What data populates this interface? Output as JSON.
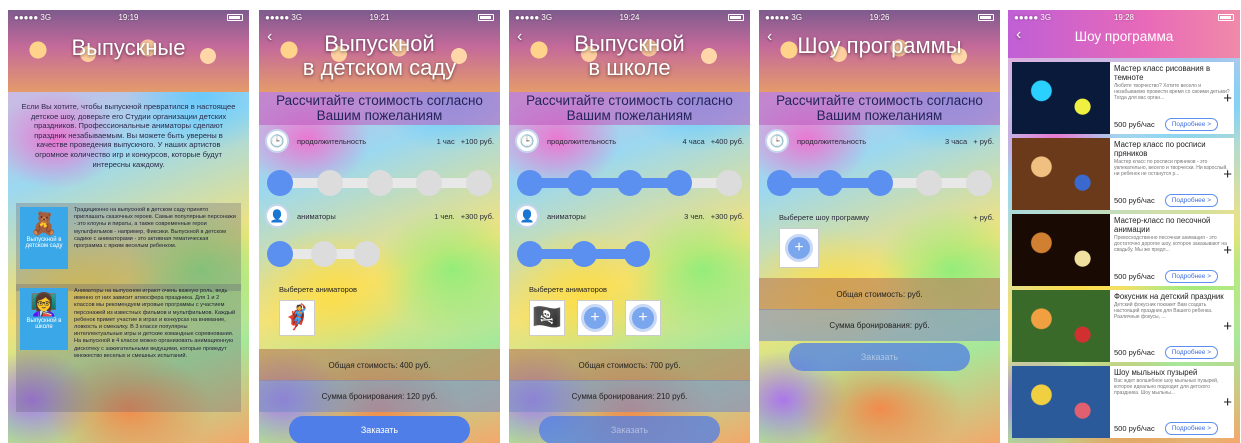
{
  "colors": {
    "accent": "#5b8ff0",
    "button": "#4f7ee8",
    "header": "#d062c8",
    "slider_inactive": "#dcdcdc"
  },
  "screens": [
    {
      "status": {
        "signal": "●●●●● 3G",
        "time": "19:19"
      },
      "title": "Выпускные",
      "intro": "Если Вы хотите, чтобы выпускной превратился в настоящее детское шоу, доверьте его Студии организации детских праздников. Профессиональные аниматоры сделают праздник незабываемым. Вы можете быть уверены в качестве проведения выпускного. У наших артистов огромное количество игр и конкурсов, которые будут интересны каждому.",
      "features": [
        {
          "tile_label": "Выпускной в детском саду",
          "icon": "teddy-bear-icon",
          "text": "Традиционно на выпускной в детском саду принято приглашать сказочных героев. Самые популярные персонажи - это клоуны и пираты, а также современные герои мультфильмов - например, Фиксики. Выпускной в детском садике с аниматорами - это активная тематическая программа с ярким веселым ребенком."
        },
        {
          "tile_label": "Выпускной в школе",
          "icon": "teacher-board-icon",
          "text": "Аниматоры на выпускном играют очень важную роль, ведь именно от них зависит атмосфера праздника. Для 1 и 2 классов мы рекомендуем игровые программы с участием персонажей из известных фильмов и мультфильмов. Каждый ребенок примет участие в играх и конкурсах на внимание, ловкость и смекалку. В 3 классе популярны интеллектуальные игры и детские командные соревнования. На выпускной в 4 классе можно организовать анимационную дискотеку с зажигательными ведущими, которые проведут множество веселых и смешных испытаний."
        }
      ]
    },
    {
      "status": {
        "signal": "●●●●● 3G",
        "time": "19:21"
      },
      "title_line1": "Выпускной",
      "title_line2": "в детском саду",
      "heading": "Рассчитайте стоимость согласно Вашим пожеланиям",
      "duration": {
        "label": "продолжительность",
        "value": "1 час",
        "price": "+100 руб.",
        "level": 1,
        "steps": 5
      },
      "animators": {
        "label": "аниматоры",
        "value": "1 чел.",
        "price": "+300 руб.",
        "level": 1,
        "steps": 3
      },
      "choose_label": "Выберете аниматоров",
      "total": "Общая стоимость: 400 руб.",
      "booking": "Сумма бронирования: 120 руб.",
      "order": "Заказать"
    },
    {
      "status": {
        "signal": "●●●●● 3G",
        "time": "19:24"
      },
      "title_line1": "Выпускной",
      "title_line2": "в школе",
      "heading": "Рассчитайте стоимость согласно Вашим пожеланиям",
      "duration": {
        "label": "продолжительность",
        "value": "4 часа",
        "price": "+400 руб.",
        "level": 4,
        "steps": 5
      },
      "animators": {
        "label": "аниматоры",
        "value": "3 чел.",
        "price": "+300 руб.",
        "level": 3,
        "steps": 3
      },
      "choose_label": "Выберете аниматоров",
      "total": "Общая стоимость: 700 руб.",
      "booking": "Сумма бронирования: 210 руб.",
      "order": "Заказать"
    },
    {
      "status": {
        "signal": "●●●●● 3G",
        "time": "19:26"
      },
      "title": "Шоу программы",
      "heading": "Рассчитайте стоимость согласно Вашим пожеланиям",
      "duration": {
        "label": "продолжительность",
        "value": "3 часа",
        "price": "+ руб.",
        "level": 3,
        "steps": 5
      },
      "show_select": {
        "label": "Выберете шоу программу",
        "price": "+ руб."
      },
      "total": "Общая стоимость: руб.",
      "booking": "Сумма бронирования: руб.",
      "order": "Заказать"
    },
    {
      "status": {
        "signal": "●●●●● 3G",
        "time": "19:28"
      },
      "title": "Шоу программа",
      "items": [
        {
          "title": "Мастер класс рисования в темноте",
          "desc": "Любите творчество? Хотите весело и незабываемо провести время со своими детьми? Тогда для вас орган...",
          "price": "500 руб/час",
          "more": "Подробнее >",
          "photo": [
            "#0a1a3a",
            "#2ad0ff",
            "#f0f040"
          ]
        },
        {
          "title": "Мастер класс по росписи пряников",
          "desc": "Мастер класс по росписи пряников - это увлекательно, весело и творчески. Ни взрослый, ни ребенок не останутся р...",
          "price": "500 руб/час",
          "more": "Подробнее >",
          "photo": [
            "#6a3a1a",
            "#f0c080",
            "#3a6ad0"
          ]
        },
        {
          "title": "Мастер-класс по песочной анимации",
          "desc": "Превосходственно песочная анимация - это достаточно дорогое шоу, которое заказывают на свадьбу. Мы же предл...",
          "price": "500 руб/час",
          "more": "Подробнее >",
          "photo": [
            "#1a0a04",
            "#d08030",
            "#f0e0a0"
          ]
        },
        {
          "title": "Фокусник на детский праздник",
          "desc": "Детский фокусник покажет Вам создать настоящий праздник для Вашего ребенка. Различные фокусы, ...",
          "price": "500 руб/час",
          "more": "Подробнее >",
          "photo": [
            "#3a6a2a",
            "#f0a040",
            "#d03030"
          ]
        },
        {
          "title": "Шоу мыльных пузырей",
          "desc": "Вас ждет волшебное шоу мыльных пузырей, которое идеально подходит для детского праздника. Шоу мыльны...",
          "price": "500 руб/час",
          "more": "Подробнее >",
          "photo": [
            "#2a5a9a",
            "#f0d040",
            "#e06070"
          ]
        }
      ]
    }
  ]
}
